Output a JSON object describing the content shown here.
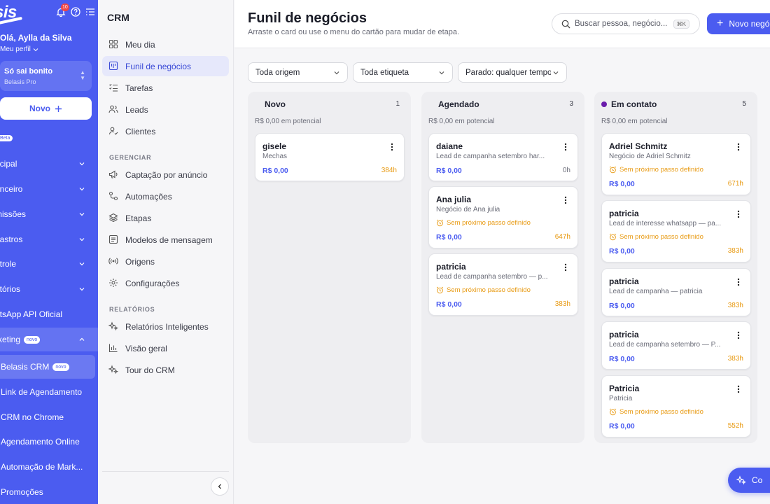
{
  "brand": {
    "logo_text": "sis"
  },
  "topbar": {
    "notifications_count": "10"
  },
  "user": {
    "greeting": "Olá, Aylla da Silva",
    "profile_link": "Meu perfil"
  },
  "company": {
    "name": "Só sai bonito",
    "plan": "Belasis Pro"
  },
  "novo_button": {
    "label": "Novo"
  },
  "beta_label": "Beta",
  "main_nav": [
    {
      "label": "ncipal"
    },
    {
      "label": "anceiro"
    },
    {
      "label": "missões"
    },
    {
      "label": "dastros"
    },
    {
      "label": "ntrole"
    },
    {
      "label": "atórios"
    },
    {
      "label": "atsApp API Oficial"
    },
    {
      "label": "rketing",
      "pill": "novo"
    }
  ],
  "marketing_sub": [
    {
      "label": "Belasis CRM",
      "pill": "novo"
    },
    {
      "label": "Link de Agendamento"
    },
    {
      "label": "CRM no Chrome"
    },
    {
      "label": "Agendamento Online"
    },
    {
      "label": "Automação de Mark..."
    },
    {
      "label": "Promoções"
    }
  ],
  "crm_nav": {
    "title": "CRM",
    "items": [
      {
        "label": "Meu dia",
        "icon": "grid-icon"
      },
      {
        "label": "Funil de negócios",
        "icon": "kanban-icon"
      },
      {
        "label": "Tarefas",
        "icon": "checklist-icon"
      },
      {
        "label": "Leads",
        "icon": "users-icon"
      },
      {
        "label": "Clientes",
        "icon": "user-check-icon"
      }
    ],
    "manage_title": "GERENCIAR",
    "manage": [
      {
        "label": "Captação por anúncio",
        "icon": "megaphone-icon"
      },
      {
        "label": "Automações",
        "icon": "workflow-icon"
      },
      {
        "label": "Etapas",
        "icon": "layers-icon"
      },
      {
        "label": "Modelos de mensagem",
        "icon": "message-icon"
      },
      {
        "label": "Origens",
        "icon": "broadcast-icon"
      },
      {
        "label": "Configurações",
        "icon": "gear-icon"
      }
    ],
    "reports_title": "RELATÓRIOS",
    "reports": [
      {
        "label": "Relatórios Inteligentes",
        "icon": "sparkles-icon"
      },
      {
        "label": "Visão geral",
        "icon": "bar-chart-icon"
      },
      {
        "label": "Tour do CRM",
        "icon": "sparkles-icon"
      }
    ]
  },
  "page": {
    "title": "Funil de negócios",
    "subtitle": "Arraste o card ou use o menu do cartão para mudar de etapa."
  },
  "search": {
    "placeholder": "Buscar pessoa, negócio...",
    "shortcut": "⌘K"
  },
  "new_deal_button": {
    "label": "Novo negóc"
  },
  "filters": {
    "origin": "Toda origem",
    "tag": "Toda etiqueta",
    "stale": "Parado: qualquer tempo"
  },
  "columns": [
    {
      "title": "Novo",
      "count": "1",
      "potential": "R$ 0,00 em potencial",
      "cards": [
        {
          "name": "gisele",
          "sub": "Mechas",
          "value": "R$ 0,00",
          "age": "384h"
        }
      ]
    },
    {
      "title": "Agendado",
      "count": "3",
      "potential": "R$ 0,00 em potencial",
      "cards": [
        {
          "name": "daiane",
          "sub": "Lead de campanha setembro har...",
          "value": "R$ 0,00",
          "age": "0h"
        },
        {
          "name": "Ana julia",
          "sub": "Negócio de Ana julia",
          "warning": "Sem próximo passo definido",
          "value": "R$ 0,00",
          "age": "647h"
        },
        {
          "name": "patricia",
          "sub": "Lead de campanha setembro — p...",
          "warning": "Sem próximo passo definido",
          "value": "R$ 0,00",
          "age": "383h"
        }
      ]
    },
    {
      "title": "Em contato",
      "count": "5",
      "potential": "R$ 0,00 em potencial",
      "dot_color": "#6a1cab",
      "cards": [
        {
          "name": "Adriel Schmitz",
          "sub": "Negócio de Adriel Schmitz",
          "warning": "Sem próximo passo definido",
          "value": "R$ 0,00",
          "age": "671h"
        },
        {
          "name": "patricia",
          "sub": "Lead de interesse whatsapp — pa...",
          "warning": "Sem próximo passo definido",
          "value": "R$ 0,00",
          "age": "383h"
        },
        {
          "name": "patricia",
          "sub": "Lead de campanha — patricia",
          "value": "R$ 0,00",
          "age": "383h"
        },
        {
          "name": "patricia",
          "sub": "Lead de campanha setembro — P...",
          "value": "R$ 0,00",
          "age": "383h"
        },
        {
          "name": "Patricia",
          "sub": "Patricia",
          "warning": "Sem próximo passo definido",
          "value": "R$ 0,00",
          "age": "552h"
        }
      ]
    }
  ],
  "copilot": {
    "label": "Co"
  },
  "colors": {
    "brand": "#4b5cf0",
    "warning": "#e89a12",
    "em_contato_dot": "#6a1cab"
  }
}
